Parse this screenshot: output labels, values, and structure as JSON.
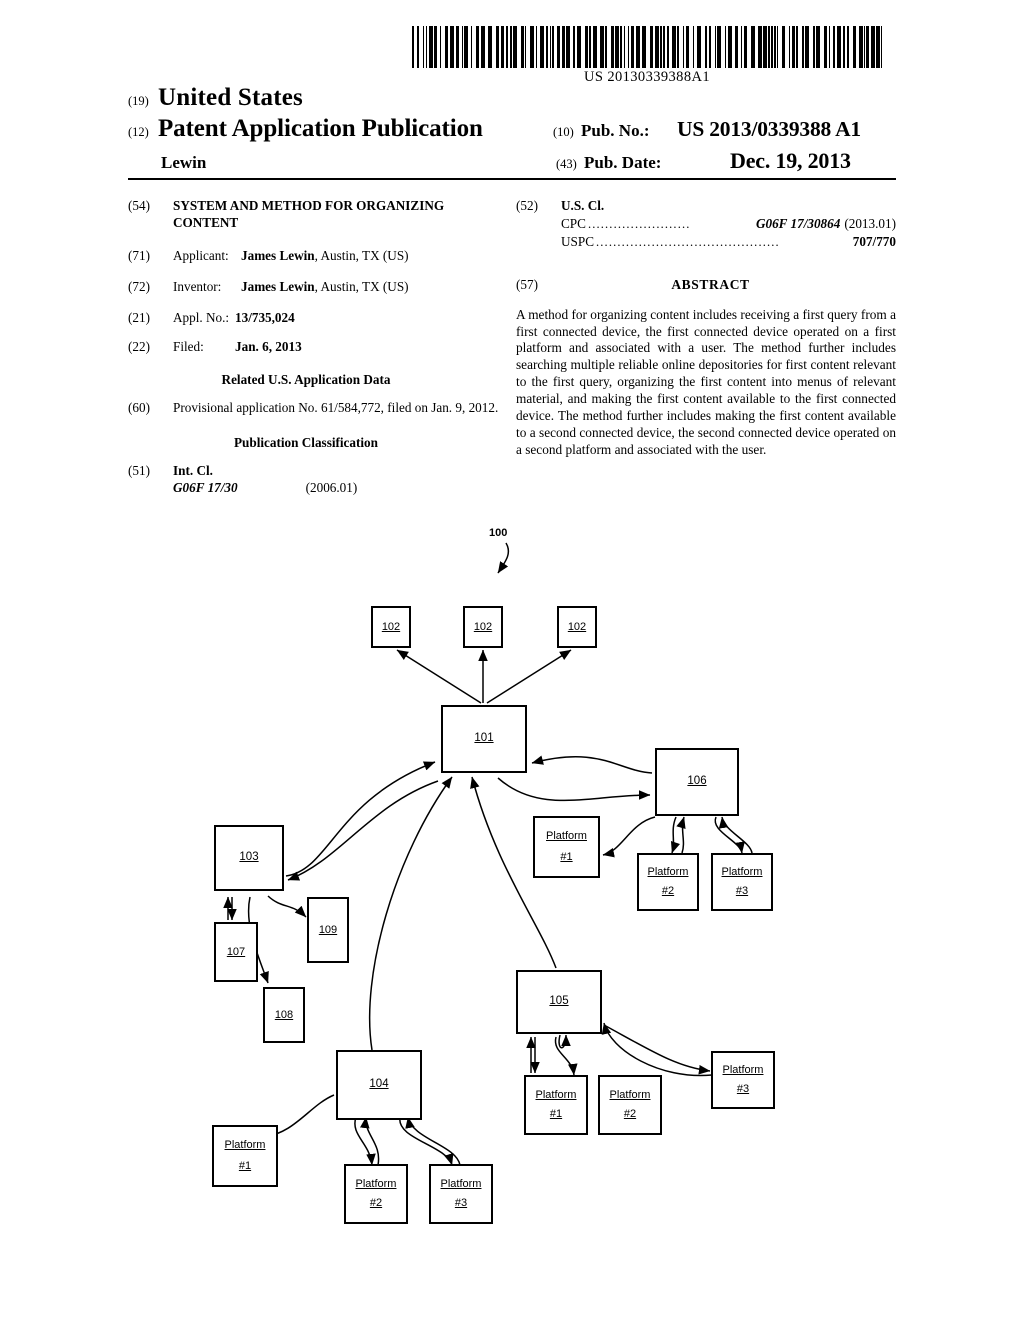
{
  "barcode": {
    "number": "US 20130339388A1"
  },
  "masthead": {
    "country_code": "(19)",
    "country": "United States",
    "doc_type_code": "(12)",
    "doc_type": "Patent Application Publication",
    "inventor_surname": "Lewin",
    "pub_no_code": "(10)",
    "pub_no_label": "Pub. No.:",
    "pub_no_value": "US 2013/0339388 A1",
    "pub_date_code": "(43)",
    "pub_date_label": "Pub. Date:",
    "pub_date_value": "Dec. 19, 2013"
  },
  "left_column": {
    "title_code": "(54)",
    "title": "SYSTEM AND METHOD FOR ORGANIZING CONTENT",
    "applicant_code": "(71)",
    "applicant_label": "Applicant:",
    "applicant_name": "James Lewin",
    "applicant_rest": ", Austin, TX (US)",
    "inventor_code": "(72)",
    "inventor_label": "Inventor:",
    "inventor_name": "James Lewin",
    "inventor_rest": ", Austin, TX (US)",
    "appl_no_code": "(21)",
    "appl_no_label": "Appl. No.:",
    "appl_no_value": "13/735,024",
    "filed_code": "(22)",
    "filed_label": "Filed:",
    "filed_value": "Jan. 6, 2013",
    "related_heading": "Related U.S. Application Data",
    "related_code": "(60)",
    "related_text": "Provisional application No. 61/584,772, filed on Jan. 9, 2012.",
    "pub_class_heading": "Publication Classification",
    "int_cl_code": "(51)",
    "int_cl_label": "Int. Cl.",
    "int_cl_value": "G06F 17/30",
    "int_cl_version": "(2006.01)"
  },
  "right_column": {
    "us_cl_code": "(52)",
    "us_cl_label": "U.S. Cl.",
    "cpc_key": "CPC",
    "cpc_dots": "........................",
    "cpc_value": "G06F 17/30864",
    "cpc_version": "(2013.01)",
    "uspc_key": "USPC",
    "uspc_dots": "...........................................",
    "uspc_value": "707/770",
    "abstract_code": "(57)",
    "abstract_heading": "ABSTRACT",
    "abstract_text": "A method for organizing content includes receiving a first query from a first connected device, the first connected device operated on a first platform and associated with a user. The method further includes searching multiple reliable online depositories for first content relevant to the first query, organizing the first content into menus of relevant material, and making the first content available to the first connected device. The method further includes making the first content available to a second connected device, the second connected device operated on a second platform and associated with the user."
  },
  "figure": {
    "figure_ref": "100",
    "nodes": {
      "n102a": "102",
      "n102b": "102",
      "n102c": "102",
      "n101": "101",
      "n106": "106",
      "n103": "103",
      "n107": "107",
      "n108": "108",
      "n109": "109",
      "n104": "104",
      "n105": "105",
      "p106_1_top": "Platform",
      "p106_1_bot": "#1",
      "p106_2_top": "Platform",
      "p106_2_bot": "#2",
      "p106_3_top": "Platform",
      "p106_3_bot": "#3",
      "p105_1_top": "Platform",
      "p105_1_bot": "#1",
      "p105_2_top": "Platform",
      "p105_2_bot": "#2",
      "p105_3_top": "Platform",
      "p105_3_bot": "#3",
      "p104_1_top": "Platform",
      "p104_1_bot": "#1",
      "p104_2_top": "Platform",
      "p104_2_bot": "#2",
      "p104_3_top": "Platform",
      "p104_3_bot": "#3"
    }
  }
}
